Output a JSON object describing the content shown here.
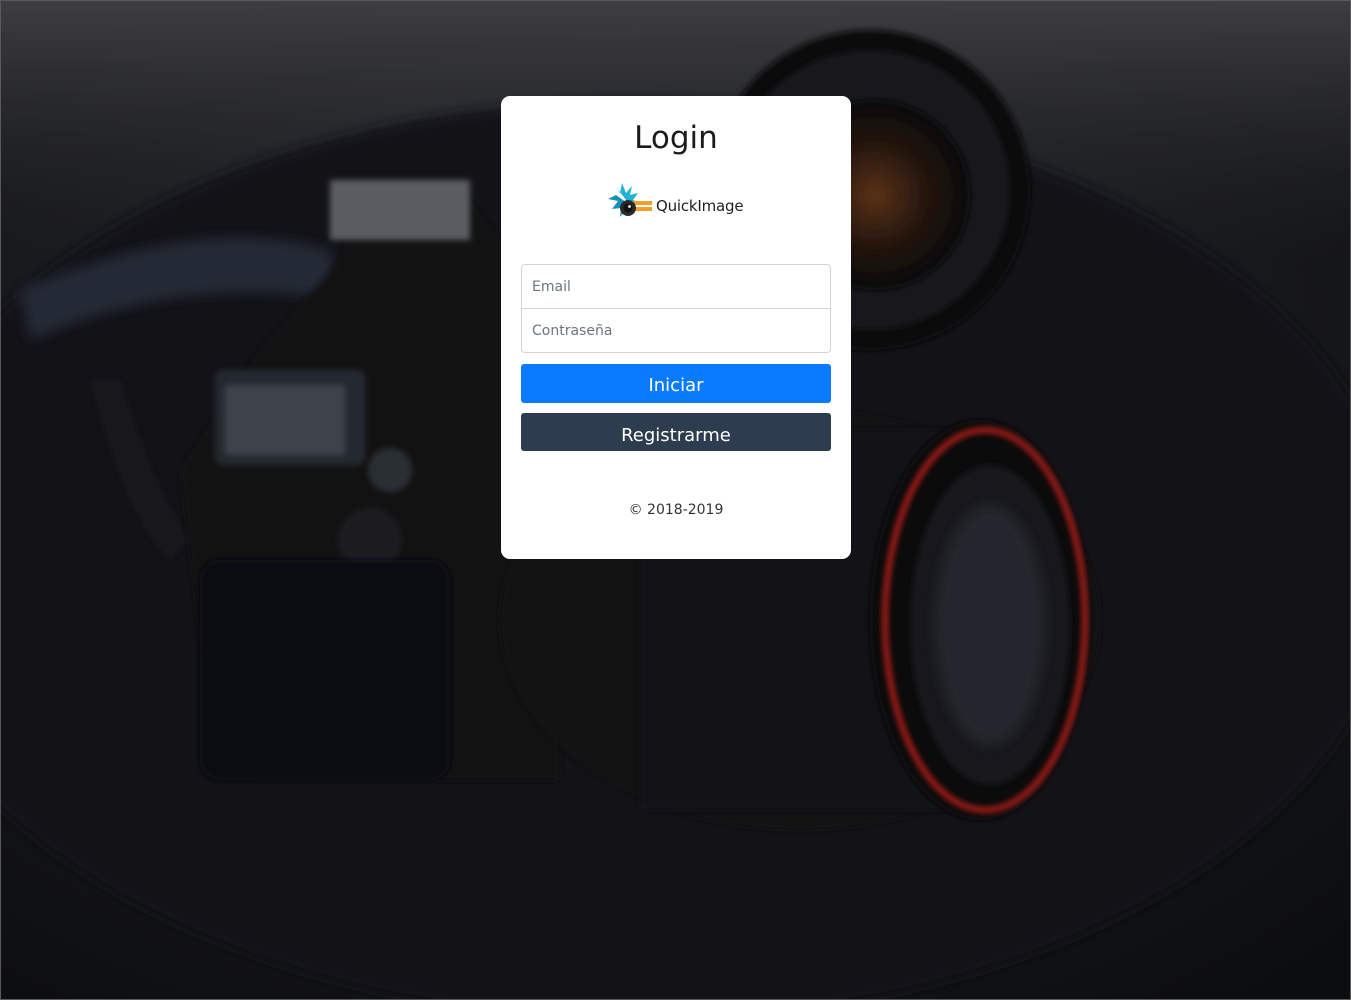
{
  "card": {
    "title": "Login",
    "logo_text": "QuickImage"
  },
  "form": {
    "email_placeholder": "Email",
    "email_value": "",
    "password_placeholder": "Contraseña",
    "password_value": ""
  },
  "buttons": {
    "login_label": "Iniciar",
    "register_label": "Registrarme"
  },
  "footer": {
    "copyright": "© 2018-2019"
  },
  "colors": {
    "login_button": "#0a7bff",
    "register_button": "#2e3c4f",
    "card_background": "#ffffff"
  }
}
